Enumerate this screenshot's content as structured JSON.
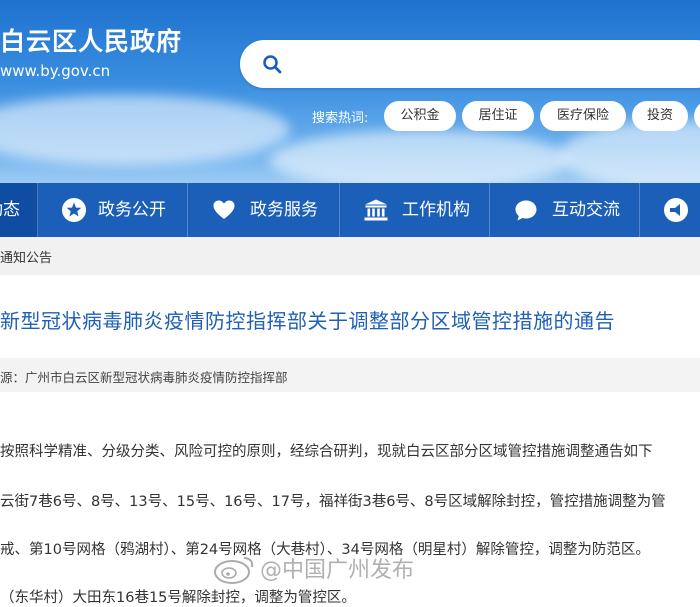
{
  "site": {
    "title": "白云区人民政府",
    "url": "www.by.gov.cn"
  },
  "search": {
    "placeholder": "",
    "hot_label": "搜索热词:",
    "hot_tags": [
      "公积金",
      "居住证",
      "医疗保险",
      "投资"
    ]
  },
  "nav": {
    "items": [
      {
        "label": "动态",
        "icon": "",
        "active": true
      },
      {
        "label": "政务公开",
        "icon": "star-icon"
      },
      {
        "label": "政务服务",
        "icon": "heart-icon"
      },
      {
        "label": "工作机构",
        "icon": "building-icon"
      },
      {
        "label": "互动交流",
        "icon": "chat-bubble-icon"
      },
      {
        "label": "",
        "icon": "megaphone-icon"
      }
    ],
    "colors": {
      "bar": "#1c5fb8",
      "active": "#0f4da3"
    }
  },
  "breadcrumb": "通知公告",
  "article": {
    "title": "新型冠状病毒肺炎疫情防控指挥部关于调整部分区域管控措施的通告",
    "source": "源：广州市白云区新型冠状病毒肺炎疫情防控指挥部",
    "paragraphs": [
      "按照科学精准、分级分类、风险可控的原则，经综合研判，现就白云区部分区域管控措施调整通告如下",
      "云街7巷6号、8号、13号、15号、16号、17号，福祥街3巷6号、8号区域解除封控，管控措施调整为管",
      "戒、第10号网格（鸦湖村）、第24号网格（大巷村）、34号网格（明星村）解除管控，调整为防范区。",
      "（东华村）大田东16巷15号解除封控，调整为管控区。"
    ]
  },
  "watermark": {
    "text": "@中国广州发布"
  }
}
